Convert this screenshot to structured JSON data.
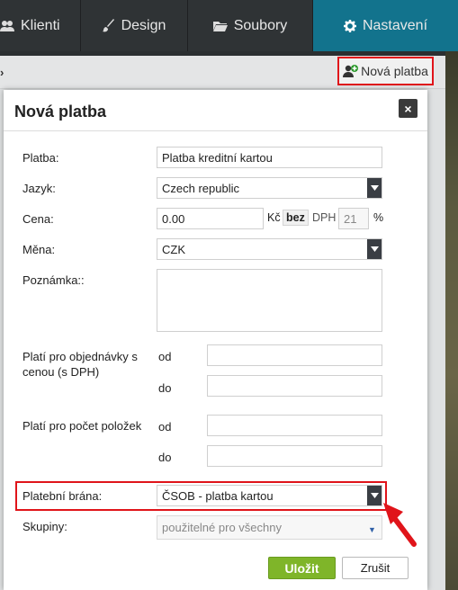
{
  "nav": {
    "tabs": [
      {
        "label": "Klienti",
        "icon": "users-icon"
      },
      {
        "label": "Design",
        "icon": "brush-icon"
      },
      {
        "label": "Soubory",
        "icon": "folder-icon"
      },
      {
        "label": "Nastavení",
        "icon": "gear-icon",
        "active": true
      }
    ]
  },
  "toolbar": {
    "new_payment_label": "Nová platba"
  },
  "modal": {
    "title": "Nová platba",
    "close_label": "×",
    "fields": {
      "platba_label": "Platba:",
      "platba_value": "Platba kreditní kartou",
      "jazyk_label": "Jazyk:",
      "jazyk_value": "Czech republic",
      "cena_label": "Cena:",
      "cena_value": "0.00",
      "currency_unit": "Kč",
      "bez_label": "bez",
      "dph_label": "DPH",
      "dph_value": "21",
      "percent": "%",
      "mena_label": "Měna:",
      "mena_value": "CZK",
      "poznamka_label": "Poznámka::",
      "poznamka_value": "",
      "plati_cena_label": "Platí pro objednávky s cenou (s DPH)",
      "od_label": "od",
      "do_label": "do",
      "plati_pocet_label": "Platí pro počet položek",
      "brana_label": "Platební brána:",
      "brana_value": "ČSOB - platba kartou",
      "skupiny_label": "Skupiny:",
      "skupiny_value": "použitelné pro všechny"
    },
    "save_label": "Uložit",
    "cancel_label": "Zrušit"
  },
  "colors": {
    "active_tab": "#12738d",
    "highlight": "#e0141a",
    "save_button": "#7fb529"
  }
}
